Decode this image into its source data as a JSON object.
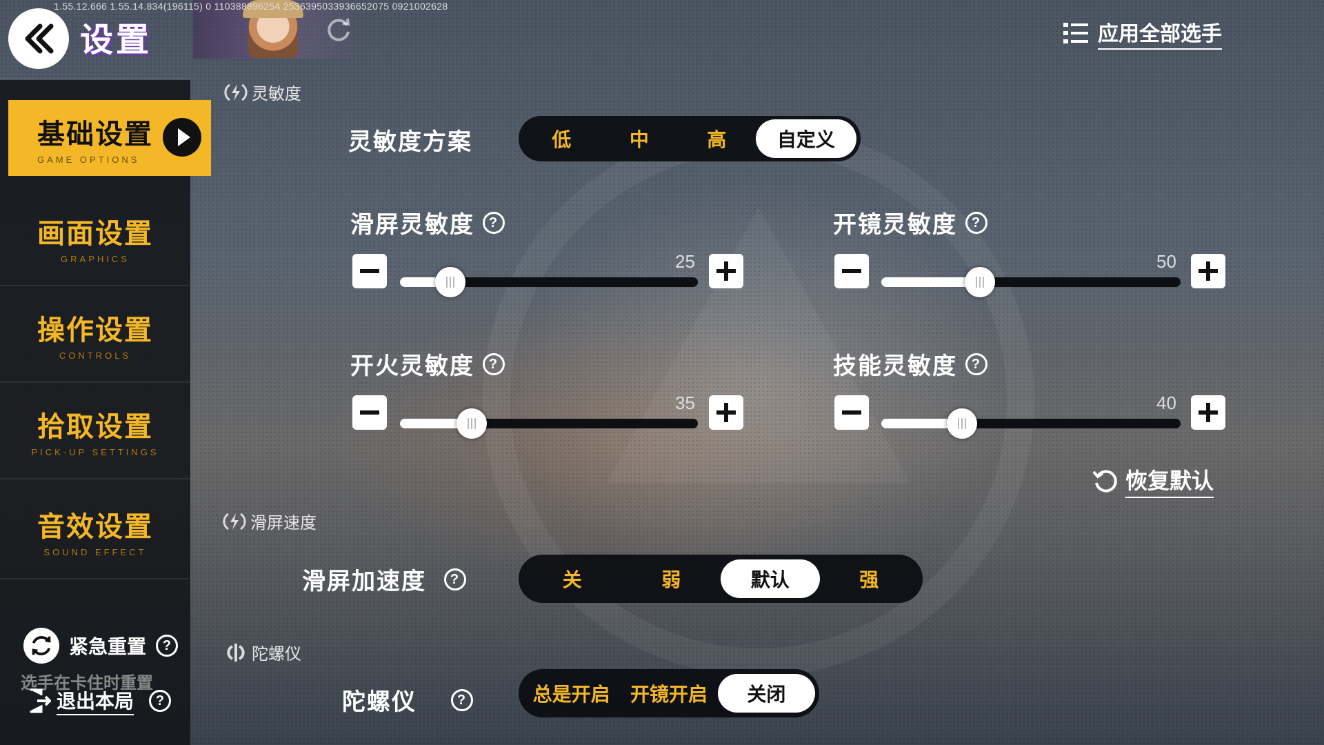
{
  "header": {
    "version_text": "1.55.12.666  1.55.14.834(196115)  0  110388896254  2536395033936652075  0921002628",
    "title": "设置",
    "apply_all": "应用全部选手"
  },
  "sidebar": {
    "items": [
      {
        "label": "基础设置",
        "sub": "GAME OPTIONS",
        "active": true
      },
      {
        "label": "画面设置",
        "sub": "GRAPHICS",
        "active": false
      },
      {
        "label": "操作设置",
        "sub": "CONTROLS",
        "active": false
      },
      {
        "label": "拾取设置",
        "sub": "PICK-UP SETTINGS",
        "active": false
      },
      {
        "label": "音效设置",
        "sub": "SOUND EFFECT",
        "active": false
      }
    ],
    "emergency_reset": "紧急重置",
    "emergency_hint": "选手在卡住时重置",
    "exit": "退出本局"
  },
  "sensitivity": {
    "section_title": "灵敏度",
    "preset_label": "灵敏度方案",
    "presets": [
      "低",
      "中",
      "高",
      "自定义"
    ],
    "active_preset": "自定义",
    "sliders": [
      {
        "label": "滑屏灵敏度",
        "value": "25",
        "fraction": 0.17
      },
      {
        "label": "开镜灵敏度",
        "value": "50",
        "fraction": 0.33
      },
      {
        "label": "开火灵敏度",
        "value": "35",
        "fraction": 0.24
      },
      {
        "label": "技能灵敏度",
        "value": "40",
        "fraction": 0.27
      }
    ],
    "restore_default": "恢复默认"
  },
  "swipe_speed": {
    "section_title": "滑屏速度",
    "accel_label": "滑屏加速度",
    "options": [
      "关",
      "弱",
      "默认",
      "强"
    ],
    "active_option": "默认"
  },
  "gyro": {
    "section_title": "陀螺仪",
    "label": "陀螺仪",
    "options": [
      "总是开启",
      "开镜开启",
      "关闭"
    ],
    "active_option": "关闭"
  },
  "colors": {
    "accent": "#f4b728",
    "panel": "#0a0c10"
  },
  "icons": [
    "back-chevrons-icon",
    "refresh-icon",
    "list-icon",
    "play-icon",
    "help-icon",
    "bolt-icon",
    "gyro-icon",
    "reset-icon",
    "exit-icon",
    "restore-icon",
    "minus-icon",
    "plus-icon"
  ]
}
